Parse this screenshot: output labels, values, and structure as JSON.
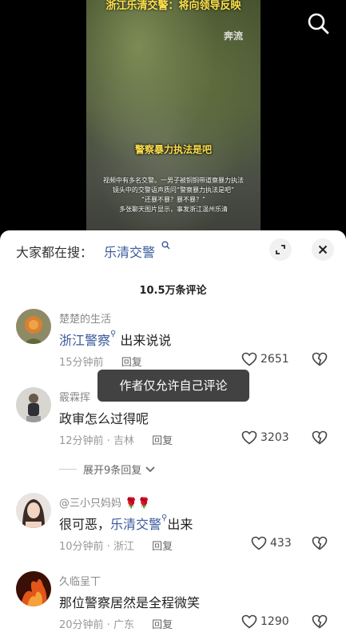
{
  "video": {
    "title": "浙江乐清交警：将向领导反映",
    "watermark": "奔流",
    "caption": "警察暴力执法是吧",
    "subtext_lines": [
      "视频中有多名交警。一男子被铜铜带道察暴力执法",
      "镜头中的交警语声质问“警察暴力执法是吧”",
      "“还暴不暴？暴不暴？”",
      "多张聊天图片显示，事发浙江温州乐清"
    ]
  },
  "search_bar": {
    "prefix": "大家都在搜：",
    "term": "乐清交警"
  },
  "comment_count": "10.5万条评论",
  "comments": [
    {
      "username": "楚楚的生活",
      "text_highlight": "浙江警察",
      "text_rest": " 出来说说",
      "time": "15分钟前",
      "location": "",
      "reply_label": "回复",
      "likes": "2651"
    },
    {
      "username": "霰霖挥",
      "text_before": "",
      "text_rest": "政审怎么过得呢",
      "time": "12分钟前",
      "location": "吉林",
      "reply_label": "回复",
      "likes": "3203"
    },
    {
      "username": "@三小只妈妈",
      "text_before": "很可恶，",
      "text_highlight": "乐清交警",
      "text_rest": "出来",
      "time": "10分钟前",
      "location": "浙江",
      "reply_label": "回复",
      "likes": "433"
    },
    {
      "username": "久临呈丅",
      "text_rest": "那位警察居然是全程微笑",
      "time": "20分钟前",
      "location": "广东",
      "reply_label": "回复",
      "likes": "1290"
    }
  ],
  "expand_replies_label": "展开9条回复",
  "toast": "作者仅允许自己评论",
  "colors": {
    "link_blue": "#3a5a9b",
    "caption_yellow": "#ffe14d",
    "muted_gray": "#999999"
  }
}
